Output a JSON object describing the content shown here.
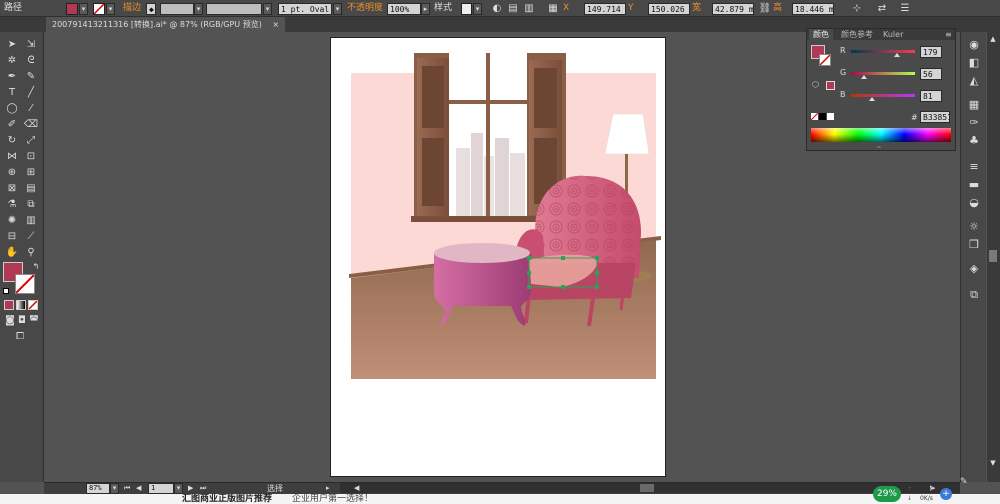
{
  "control_bar": {
    "selection_label": "路径",
    "fill_color": "#b03a56",
    "stroke_label": "描边",
    "stroke_width": "",
    "brush_value": "1 pt. Oval",
    "opacity_label": "不透明度",
    "opacity_value": "100%",
    "style_label": "样式",
    "x_label": "X",
    "x_value": "149.714 p",
    "y_label": "Y",
    "y_value": "150.026 p",
    "w_label": "宽",
    "w_value": "42.879 m",
    "h_label": "高",
    "h_value": "18.446 m"
  },
  "document": {
    "tab_title": "200791413211316 [转换].ai* @ 87% (RGB/GPU 预览)",
    "close": "×"
  },
  "color_panel": {
    "tabs": [
      "颜色",
      "颜色参考",
      "Kuler"
    ],
    "r_label": "R",
    "r_value": "179",
    "g_label": "G",
    "g_value": "56",
    "b_label": "B",
    "b_value": "81",
    "hex_label": "#",
    "hex_value": "B33851",
    "current_color": "#b33851"
  },
  "status": {
    "zoom": "87%",
    "page": "1",
    "tool_name": "选择"
  },
  "footer": {
    "text1": "汇图商业正版图片推荐",
    "text2": "企业用户第一选择！",
    "percent": "29%",
    "net1": "0K/s",
    "net2": "0K/s"
  },
  "colors": {
    "fill": "#b03a56",
    "wall": "#fcd9d5",
    "floor": "#a67a60",
    "chair": "#d15b7c",
    "table": "#c85a8f",
    "accent": "#e8902a"
  }
}
